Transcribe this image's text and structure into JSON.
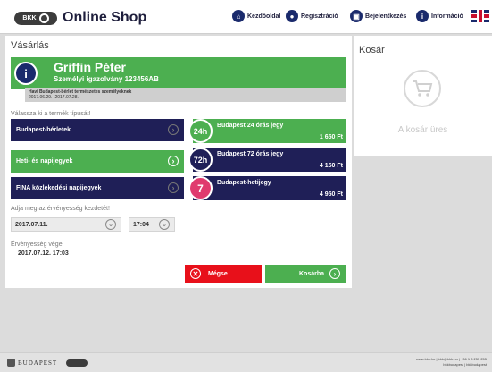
{
  "header": {
    "logo_text": "BKK",
    "title": "Online Shop",
    "nav": [
      {
        "label": "Kezdőoldal",
        "icon": "home-icon"
      },
      {
        "label": "Regisztráció",
        "icon": "user-add-icon"
      },
      {
        "label": "Bejelentkezés",
        "icon": "lock-icon"
      },
      {
        "label": "Információ",
        "icon": "info-icon"
      }
    ],
    "language_flag": "uk-flag-icon"
  },
  "purchase": {
    "title": "Vásárlás",
    "user_name": "Griffin Péter",
    "user_id": "Személyi igazolvány 123456AB",
    "ticket_info_line1": "Havi Budapest-bérlet természetes személyeknek",
    "ticket_info_line2": "2017.06.29.- 2017.07.28.",
    "choose_type_label": "Válassza ki a termék típusát!",
    "categories": [
      {
        "label": "Budapest-bérletek",
        "color": "#1f1f57"
      },
      {
        "label": "Heti- és napijegyek",
        "color": "#4caf50"
      },
      {
        "label": "FINA közlekedési napijegyek",
        "color": "#1f1f57"
      }
    ],
    "products": [
      {
        "badge": "24h",
        "name": "Budapest 24 órás jegy",
        "price": "1 650 Ft",
        "color": "#4caf50"
      },
      {
        "badge": "72h",
        "name": "Budapest 72 órás jegy",
        "price": "4 150 Ft",
        "color": "#1f1f57"
      },
      {
        "badge": "7",
        "name": "Budapest-hetijegy",
        "price": "4 950 Ft",
        "color": "#1f1f57",
        "badge_color": "#e03a6e"
      }
    ],
    "validity_start_label": "Adja meg az érvényesség kezdetét!",
    "start_date": "2017.07.11.",
    "start_time": "17:04",
    "validity_end_label": "Érvényesség vége:",
    "end_value": "2017.07.12. 17:03",
    "cancel_label": "Mégse",
    "cart_button_label": "Kosárba"
  },
  "cart": {
    "title": "Kosár",
    "empty_text": "A kosár üres"
  },
  "footer": {
    "city_text": "BUDAPEST",
    "contact_line1": "www.bkk.hu | bkk@bkk.hu | +36 1 3 255 255",
    "contact_line2": "bkkbudapest | bkkbudapest"
  },
  "colors": {
    "navy": "#1f1f57",
    "green": "#4caf50",
    "red": "#e8101a",
    "pink": "#e03a6e"
  }
}
